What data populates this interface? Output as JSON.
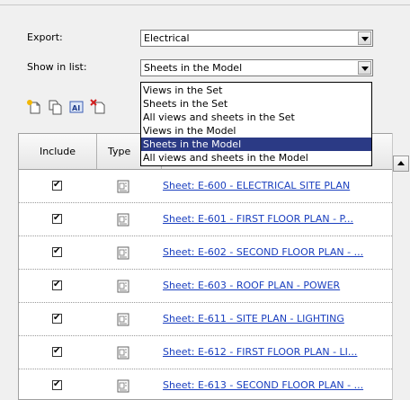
{
  "export": {
    "label": "Export:",
    "value": "Electrical"
  },
  "show_in_list": {
    "label": "Show in list:",
    "value": "Sheets in the Model"
  },
  "dropdown": {
    "options": [
      "Views in the Set",
      "Sheets in the Set",
      "All views and sheets in the Set",
      "Views in the Model",
      "Sheets in the Model",
      "All views and sheets in the Model"
    ],
    "selected_index": 4
  },
  "toolbar": {
    "icons": [
      "new-set-icon",
      "duplicate-set-icon",
      "rename-set-icon",
      "delete-set-icon"
    ]
  },
  "table": {
    "headers": {
      "include": "Include",
      "type": "Type"
    },
    "rows": [
      {
        "included": true,
        "name": "Sheet: E-600 - ELECTRICAL SITE PLAN"
      },
      {
        "included": true,
        "name": "Sheet: E-601 - FIRST FLOOR PLAN - P..."
      },
      {
        "included": true,
        "name": "Sheet: E-602 - SECOND FLOOR PLAN - ..."
      },
      {
        "included": true,
        "name": "Sheet: E-603 - ROOF PLAN - POWER"
      },
      {
        "included": true,
        "name": "Sheet: E-611 - SITE PLAN - LIGHTING"
      },
      {
        "included": true,
        "name": "Sheet: E-612 - FIRST FLOOR PLAN - LI..."
      },
      {
        "included": true,
        "name": "Sheet: E-613 - SECOND FLOOR PLAN - ..."
      }
    ]
  },
  "colors": {
    "selection": "#2b3a85",
    "link": "#1a3fbf",
    "background": "#f0f0f0"
  }
}
